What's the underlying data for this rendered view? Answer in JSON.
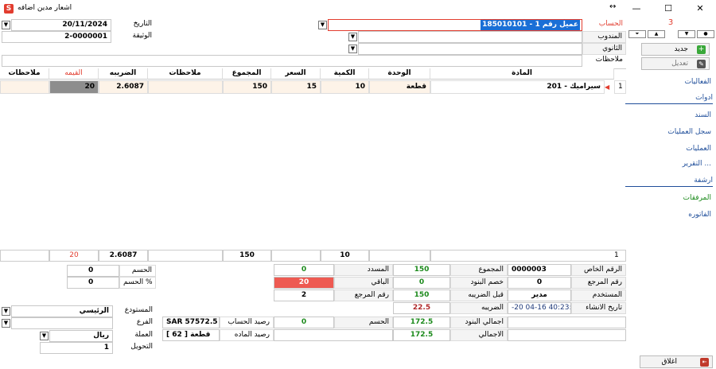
{
  "window": {
    "title": "اشعار مدين اضافه",
    "resize_glyph": "↔",
    "minimize": "—",
    "maximize": "☐",
    "close": "✕"
  },
  "header": {
    "account_label": "الحساب",
    "account_value": "185010101 - عميل رقم 1",
    "agent_label": "المندوب",
    "agent_value": "",
    "secondary_label": "الثانوي",
    "secondary_value": "",
    "date_label": "التاريخ",
    "date_value": "20/11/2024",
    "doc_label": "الوثيقة",
    "doc_value": "2-0000001",
    "notes_label": "ملاحظات",
    "notes_value": "",
    "record_counter": "3"
  },
  "grid": {
    "columns": [
      "المادة",
      "الوحدة",
      "الكمية",
      "السعر",
      "المجموع",
      "ملاحظات",
      "الضريبه",
      "القيمه",
      "ملاحظات"
    ],
    "row": {
      "index": "1",
      "item": "201 - سيراميك",
      "unit": "قطعة",
      "qty": "10",
      "price": "15",
      "total": "150",
      "notes": "",
      "tax": "2.6087",
      "value": "20",
      "notes2": ""
    }
  },
  "totals": {
    "index": "1",
    "qty": "10",
    "total": "150",
    "tax": "2.6087",
    "value": "20"
  },
  "sidebar": {
    "new_label": "جديد",
    "edit_label": "تعديل",
    "activities": "الفعاليات",
    "tools_head": "ادوات",
    "voucher": "السند",
    "ops_log": "سجل العمليات",
    "operations": "العمليات",
    "report": "التقرير ...",
    "archive_head": "ارشفة",
    "attachments": "المرفقات",
    "invoice": "الفاتوره",
    "close_label": "اغلاق"
  },
  "summary": {
    "private_no_label": "الرقم الخاص",
    "private_no": "0000003",
    "ref_no_label": "رقم المرجع",
    "ref_no": "0",
    "user_label": "المستخدم",
    "user": "مدير",
    "created_label": "تاريخ الانشاء",
    "created": "-20 04-16 40:23:",
    "total_label": "المجموع",
    "total": "150",
    "item_discount_label": "خصم البنود",
    "item_discount": "0",
    "before_tax_label": "قبل الضريبه",
    "before_tax": "150",
    "tax_label": "الضريبه",
    "tax": "22.5",
    "items_total_label": "اجمالي البنود",
    "items_total": "172.5",
    "grand_total_label": "الاجمالي",
    "grand_total": "172.5",
    "paid_label": "المسدد",
    "paid": "0",
    "remaining_label": "الباقي",
    "remaining": "20",
    "ref_no2_label": "رقم المرجع",
    "ref_no2": "2",
    "discount_label": "الحسم",
    "discount": "0",
    "acct_balance_label": "رصيد الحساب",
    "acct_balance": "SAR 57572.5",
    "item_balance_label": "رصيد الماده",
    "item_balance": "[ 62 ] قطعة"
  },
  "left_panel": {
    "discount_label": "الحسم",
    "discount": "0",
    "discount_pct_label": "الحسم %",
    "discount_pct": "0",
    "warehouse_label": "المستودع",
    "warehouse": "الرئيسي",
    "branch_label": "الفرع",
    "branch": "",
    "currency_label": "العملة",
    "currency": "ريال",
    "conversion_label": "التحويل",
    "conversion": "1"
  },
  "colors": {
    "accent_red": "#e23d2f",
    "link_blue": "#1f4e9a",
    "green": "#1c8a1c",
    "row_bg": "#fdf3e8",
    "selection": "#1a6fd6",
    "value_cell": "#8d8d8d",
    "remaining_bg": "#ee5a52"
  }
}
